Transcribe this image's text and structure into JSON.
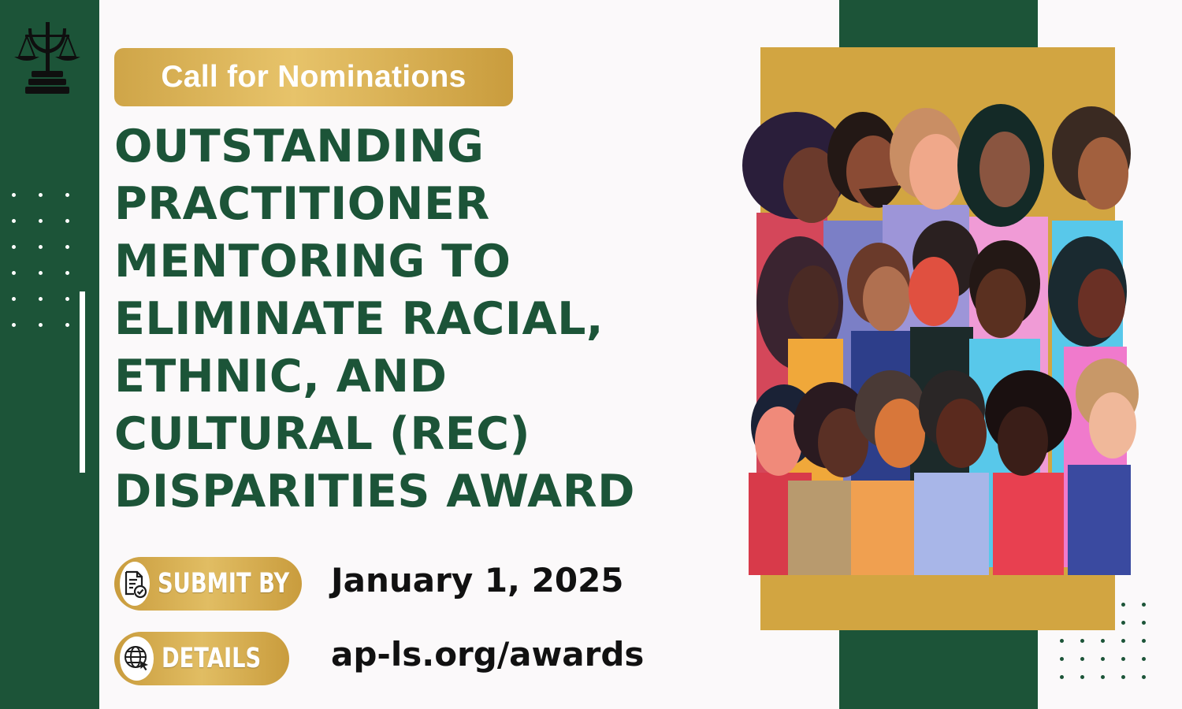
{
  "banner": {
    "label": "Call for Nominations"
  },
  "title_lines": [
    "OUTSTANDING",
    "PRACTITIONER",
    "MENTORING TO",
    "ELIMINATE RACIAL,",
    "ETHNIC, AND",
    "CULTURAL (REC)",
    "DISPARITIES AWARD"
  ],
  "submit": {
    "badge_label": "SUBMIT BY",
    "icon": "document-check-icon",
    "value": "January 1, 2025"
  },
  "details": {
    "badge_label": "DETAILS",
    "icon": "globe-cursor-icon",
    "value": "ap-ls.org/awards"
  },
  "logo": {
    "icon": "psi-scales-books-logo"
  },
  "illustration": {
    "icon": "diverse-crowd-profiles-illustration"
  },
  "colors": {
    "brand_green": "#1c5438",
    "gold": "#d2a541",
    "background": "#fbf9fa"
  }
}
